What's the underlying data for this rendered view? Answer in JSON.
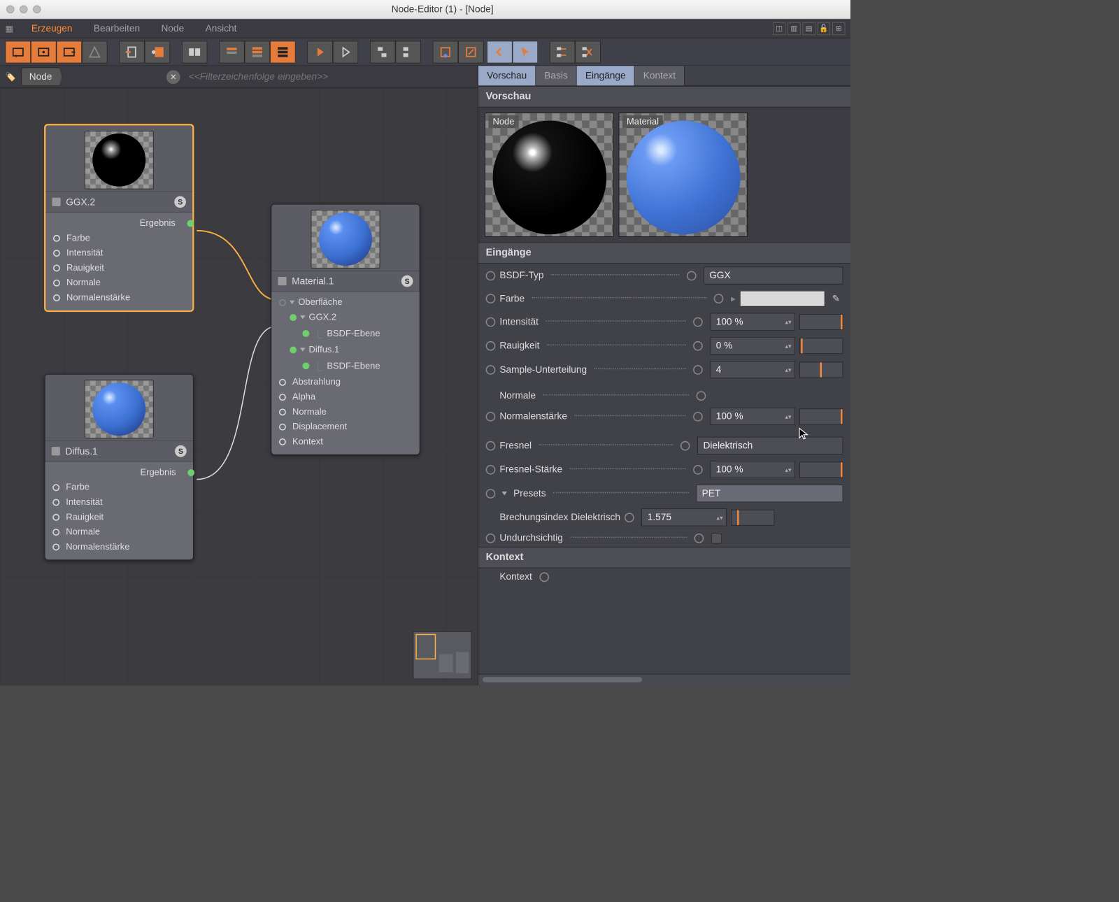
{
  "window": {
    "title": "Node-Editor (1) - [Node]"
  },
  "menu": {
    "icon": "grid-icon",
    "items": [
      "Erzeugen",
      "Bearbeiten",
      "Node",
      "Ansicht"
    ],
    "active": 0
  },
  "crumb": {
    "label": "Node",
    "filter_placeholder": "<<Filterzeichenfolge eingeben>>"
  },
  "nodes": {
    "ggx": {
      "title": "GGX.2",
      "output": "Ergebnis",
      "inputs": [
        "Farbe",
        "Intensität",
        "Rauigkeit",
        "Normale",
        "Normalenstärke"
      ]
    },
    "diffus": {
      "title": "Diffus.1",
      "output": "Ergebnis",
      "inputs": [
        "Farbe",
        "Intensität",
        "Rauigkeit",
        "Normale",
        "Normalenstärke"
      ]
    },
    "material": {
      "title": "Material.1",
      "tree": {
        "oberflache": "Oberfläche",
        "ggx": "GGX.2",
        "bsdf1": "BSDF-Ebene",
        "diffus": "Diffus.1",
        "bsdf2": "BSDF-Ebene"
      },
      "inputs": [
        "Abstrahlung",
        "Alpha",
        "Normale",
        "Displacement",
        "Kontext"
      ]
    }
  },
  "panel": {
    "tabs": [
      "Vorschau",
      "Basis",
      "Eingänge",
      "Kontext"
    ],
    "sections": {
      "vorschau": "Vorschau",
      "eingange": "Eingänge",
      "kontext": "Kontext"
    },
    "preview": {
      "node_label": "Node",
      "material_label": "Material"
    },
    "props": {
      "bsdf_typ": {
        "label": "BSDF-Typ",
        "value": "GGX"
      },
      "farbe": {
        "label": "Farbe"
      },
      "intensitat": {
        "label": "Intensität",
        "value": "100 %"
      },
      "rauigkeit": {
        "label": "Rauigkeit",
        "value": "0 %"
      },
      "sample": {
        "label": "Sample-Unterteilung",
        "value": "4"
      },
      "normale": {
        "label": "Normale"
      },
      "normalenstarke": {
        "label": "Normalenstärke",
        "value": "100 %"
      },
      "fresnel": {
        "label": "Fresnel",
        "value": "Dielektrisch"
      },
      "fresnel_starke": {
        "label": "Fresnel-Stärke",
        "value": "100 %"
      },
      "presets": {
        "label": "Presets",
        "value": "PET"
      },
      "brechungsindex": {
        "label": "Brechungsindex Dielektrisch",
        "value": "1.575"
      },
      "undurchsichtig": {
        "label": "Undurchsichtig"
      },
      "kontext": {
        "label": "Kontext"
      }
    }
  }
}
